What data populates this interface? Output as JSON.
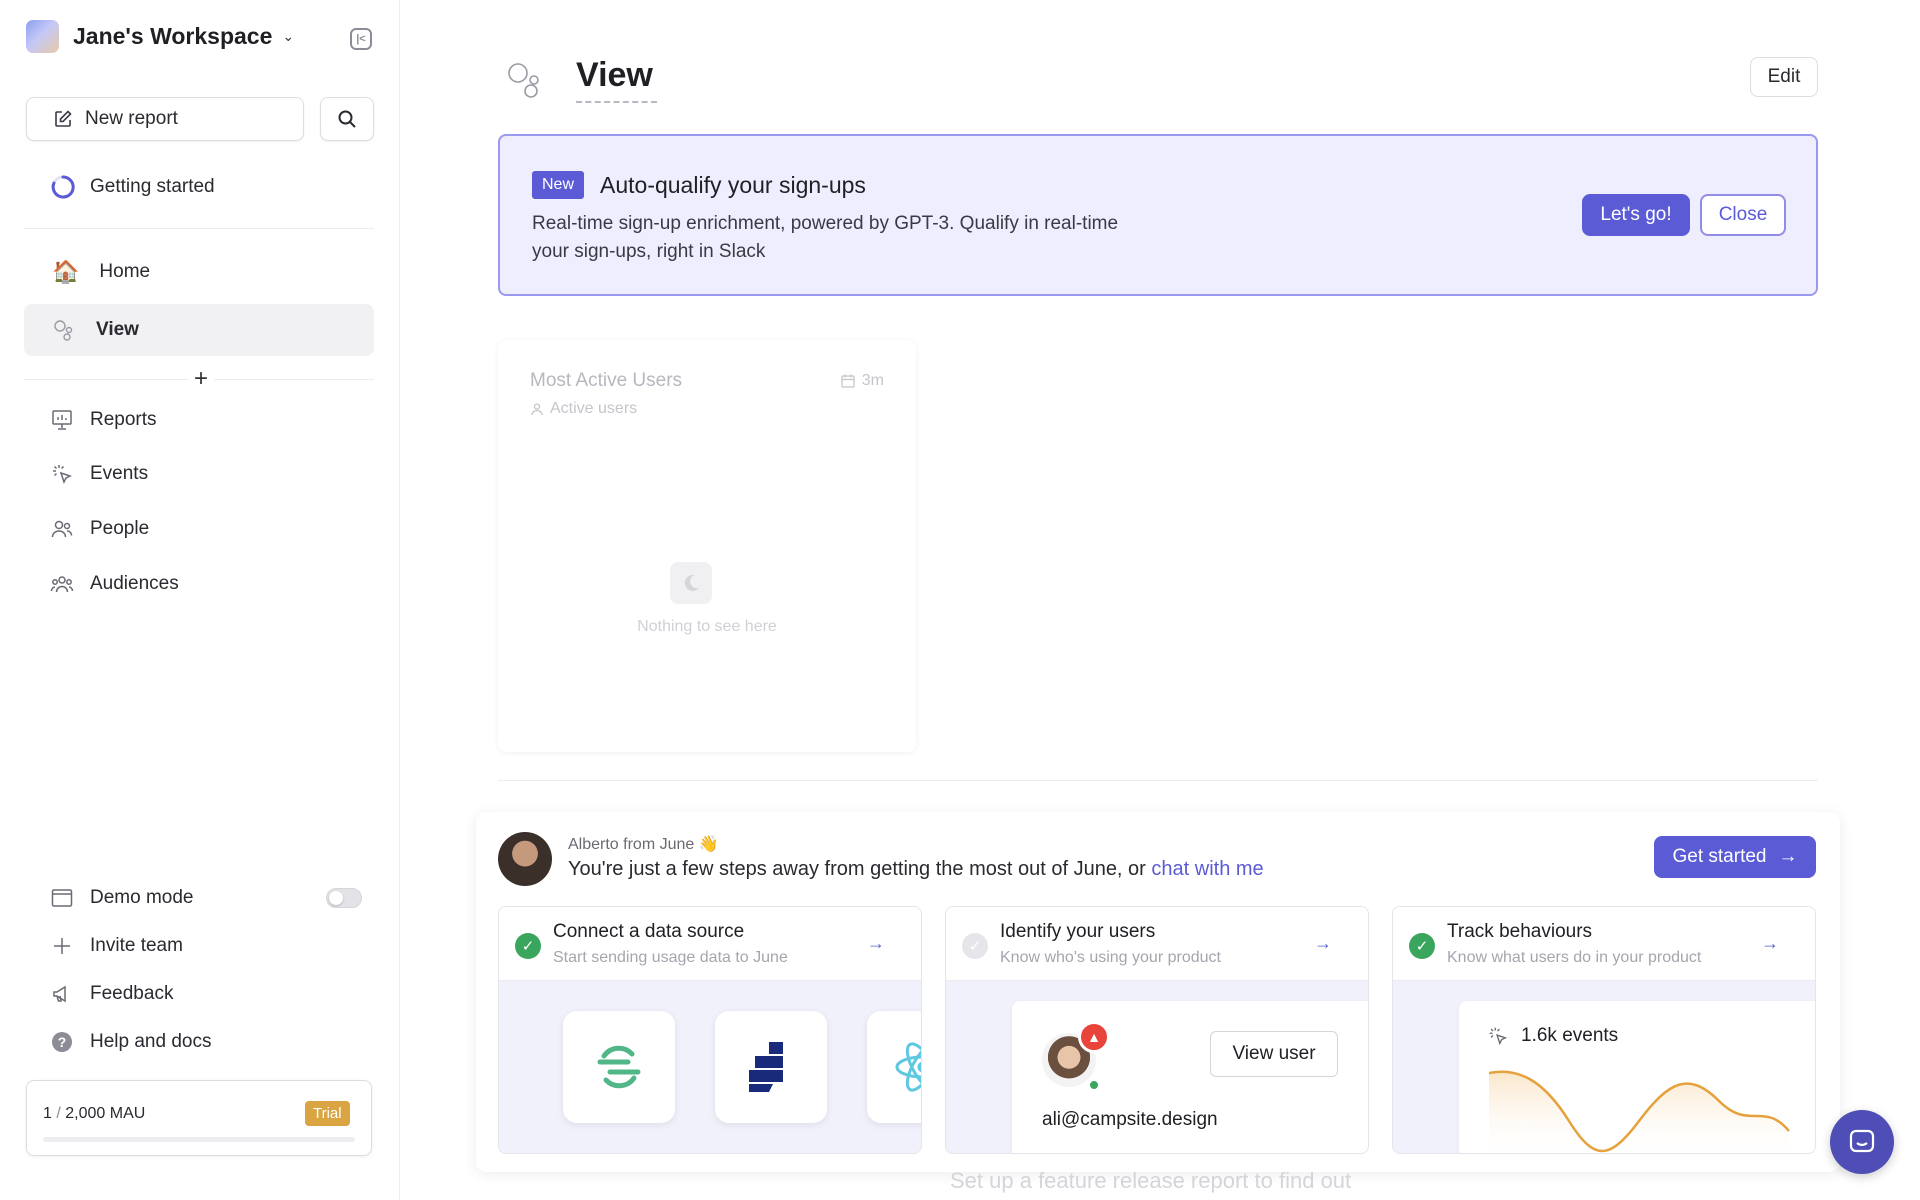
{
  "sidebar": {
    "workspace_name": "Jane's Workspace",
    "new_report_label": "New report",
    "getting_started_label": "Getting started",
    "nav": [
      {
        "label": "Home",
        "icon": "house-icon"
      },
      {
        "label": "View",
        "icon": "bubbles-icon",
        "active": true
      }
    ],
    "sections": [
      {
        "label": "Reports",
        "icon": "presentation-icon"
      },
      {
        "label": "Events",
        "icon": "cursor-click-icon"
      },
      {
        "label": "People",
        "icon": "people-icon"
      },
      {
        "label": "Audiences",
        "icon": "audience-icon"
      }
    ],
    "bottom": [
      {
        "label": "Demo mode",
        "icon": "window-icon"
      },
      {
        "label": "Invite team",
        "icon": "plus-icon"
      },
      {
        "label": "Feedback",
        "icon": "megaphone-icon"
      },
      {
        "label": "Help and docs",
        "icon": "help-icon"
      }
    ],
    "demo_mode_on": false,
    "mau": {
      "used": "1",
      "separator": "/",
      "limit": "2,000 MAU",
      "plan": "Trial",
      "fraction": 0.0005
    }
  },
  "main": {
    "title": "View",
    "edit_label": "Edit",
    "banner": {
      "badge": "New",
      "title": "Auto-qualify your sign-ups",
      "description_line1": "Real-time sign-up enrichment, powered by GPT-3. Qualify in real-time",
      "description_line2": "your sign-ups, right in Slack",
      "primary_label": "Let's go!",
      "secondary_label": "Close"
    },
    "report_card": {
      "title": "Most Active Users",
      "subtitle": "Active users",
      "timeframe": "3m",
      "empty_text": "Nothing to see here"
    },
    "onboarding": {
      "from": "Alberto from June 👋",
      "message_prefix": "You're just a few steps away from getting the most out of June, or ",
      "message_link": "chat with me",
      "cta_label": "Get started",
      "steps": [
        {
          "title": "Connect a data source",
          "subtitle": "Start sending usage data to June",
          "done": true
        },
        {
          "title": "Identify your users",
          "subtitle": "Know who's using your product",
          "done": false
        },
        {
          "title": "Track behaviours",
          "subtitle": "Know what users do in your product",
          "done": true
        }
      ],
      "user_email": "ali@campsite.design",
      "view_user_label": "View user",
      "events_label": "1.6k events"
    },
    "faded_text": "Set up a feature release report to find out"
  },
  "colors": {
    "accent": "#5b5bd6",
    "banner_bg": "#eeeefe",
    "success": "#3aa55d",
    "trial": "#d9a441",
    "chart_line": "#e5a13c"
  }
}
